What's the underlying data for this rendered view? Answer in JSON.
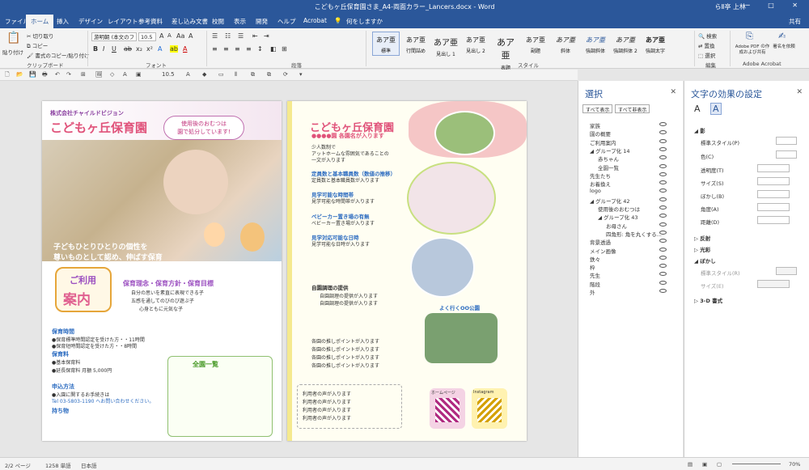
{
  "window": {
    "title": "こどもヶ丘保育園さま_A4-両面カラー_Lancers.docx - Word",
    "user": "らⅡ亭 上林",
    "controls": "─ □ ✕"
  },
  "tabs": [
    "ファイル",
    "ホーム",
    "挿入",
    "デザイン",
    "レイアウト",
    "参考資料",
    "差し込み文書",
    "校閲",
    "表示",
    "開発",
    "ヘルプ",
    "Acrobat"
  ],
  "tell_me": "何をしますか",
  "share": "共有",
  "ribbon": {
    "clipboard": {
      "cut": "切り取り",
      "copy": "コピー",
      "format_painter": "書式のコピー/貼り付け",
      "paste": "貼り付け",
      "label": "クリップボード"
    },
    "font": {
      "name": "游明朝 (本文のフ",
      "size": "10.5",
      "label": "フォント"
    },
    "paragraph": {
      "label": "段落"
    },
    "styles": {
      "label": "スタイル",
      "items": [
        {
          "preview": "あア亜",
          "name": "標準"
        },
        {
          "preview": "あア亜",
          "name": "行間詰め"
        },
        {
          "preview": "あア亜",
          "name": "見出し 1"
        },
        {
          "preview": "あア亜",
          "name": "見出し 2"
        },
        {
          "preview": "あア亜",
          "name": "表題"
        },
        {
          "preview": "あア亜",
          "name": "副題"
        },
        {
          "preview": "あア亜",
          "name": "斜体"
        },
        {
          "preview": "あア亜",
          "name": "強調斜体"
        },
        {
          "preview": "あア亜",
          "name": "強調斜体 2"
        },
        {
          "preview": "あア亜",
          "name": "強調太字"
        }
      ]
    },
    "editing": {
      "find": "検索",
      "replace": "置換",
      "select": "選択",
      "label": "編集"
    },
    "acrobat": {
      "btn1": "Adobe PDF の作成および共有",
      "btn2": "署名を依頼",
      "label": "Adobe Acrobat"
    }
  },
  "qat": {
    "font_size": "10.5"
  },
  "selection_pane": {
    "title": "選択",
    "show_all": "すべて表示",
    "hide_all": "すべて非表示",
    "items": [
      {
        "label": "家族",
        "indent": 0
      },
      {
        "label": "園の概要",
        "indent": 0
      },
      {
        "label": "ご利用案内",
        "indent": 0
      },
      {
        "label": "◢ グループ化 14",
        "indent": 0
      },
      {
        "label": "赤ちゃん",
        "indent": 1
      },
      {
        "label": "全園一覧",
        "indent": 1
      },
      {
        "label": "先生たち",
        "indent": 0
      },
      {
        "label": "お着換え",
        "indent": 0
      },
      {
        "label": "logo",
        "indent": 0
      },
      {
        "label": "◢ グループ化 42",
        "indent": 0
      },
      {
        "label": "使用後のおむつは",
        "indent": 1
      },
      {
        "label": "◢ グループ化 43",
        "indent": 1
      },
      {
        "label": "お母さん",
        "indent": 2
      },
      {
        "label": "四角形: 角を丸くする...",
        "indent": 2
      },
      {
        "label": "背景透過",
        "indent": 0
      },
      {
        "label": "メイン画像",
        "indent": 0
      },
      {
        "label": "鉄々",
        "indent": 0
      },
      {
        "label": "枠",
        "indent": 0
      },
      {
        "label": "先生",
        "indent": 0
      },
      {
        "label": "階段",
        "indent": 0
      },
      {
        "label": "外",
        "indent": 0
      }
    ]
  },
  "effects_pane": {
    "title": "文字の効果の設定",
    "shadow": "影",
    "preset": "標準スタイル(P)",
    "color": "色(C)",
    "transparency": "透明度(T)",
    "size": "サイズ(S)",
    "blur": "ぼかし(B)",
    "angle": "角度(A)",
    "distance": "距離(D)",
    "reflection": "反射",
    "glow": "光彩",
    "soft_edges": "ぼかし",
    "soft_preset": "標準スタイル(R)",
    "soft_size": "サイズ(E)",
    "three_d": "3-D 書式"
  },
  "status": {
    "page": "2/2 ページ",
    "words": "1258 単語",
    "lang": "日本語",
    "zoom": "70%"
  },
  "page1": {
    "company": "株式会社チャイルドビジョン",
    "logo": "こどもヶ丘保育園",
    "bubble1": "使用後のおむつは",
    "bubble2": "園で処分しています!",
    "tagline1": "子どもひとりひとりの個性を",
    "tagline2": "尊いものとして認め、伸ばす保育",
    "guide1": "ご利用",
    "guide2": "案内",
    "policy": "保育理念・保育方針・保育目標",
    "policy1": "自分の思いを素直に表現できる子",
    "policy2": "五感を通してのびのび遊ぶ子",
    "policy3": "心身ともに元気な子",
    "hours": "保育時間",
    "fee": "保育料",
    "apply": "申込方法",
    "items": "持ち物",
    "tel": "Tel 03-5803-1190 へお問い合わせください。",
    "list": "全園一覧",
    "lines": [
      "●保育標準時間認定を受けた方・・11時間",
      "●保育短時間認定を受けた方・・8時間",
      "●基本保育料",
      "●延長保育料 月額 5,000円",
      "●入園に関するお手続きは"
    ]
  },
  "page2": {
    "logo": "こどもヶ丘保育園",
    "sub": "●●●●園 各園名が入ります",
    "h1": "定員数と基本職員数（数値の推移）",
    "h2": "見学可能な時間帯",
    "h3": "ベビーカー置き場の有無",
    "h4": "見学対応可能な日時",
    "h5": "自園調理の提供",
    "caption": "よく行くOO公園",
    "note": "利用者の声が入ります",
    "hp": "ホームページ",
    "ig": "Instagram",
    "t1": "少人数制で",
    "t2": "アットホームな雰囲気であることの",
    "t3": "一文が入ります",
    "l1": "定員数と基本職員数が入ります",
    "l2": "見学可能な時間帯が入ります",
    "l3": "ベビーカー置き場が入ります",
    "l4": "見学可能な日時が入ります",
    "l5": "自園調理の提供が入ります",
    "l6": "各園の推しポイントが入ります"
  }
}
